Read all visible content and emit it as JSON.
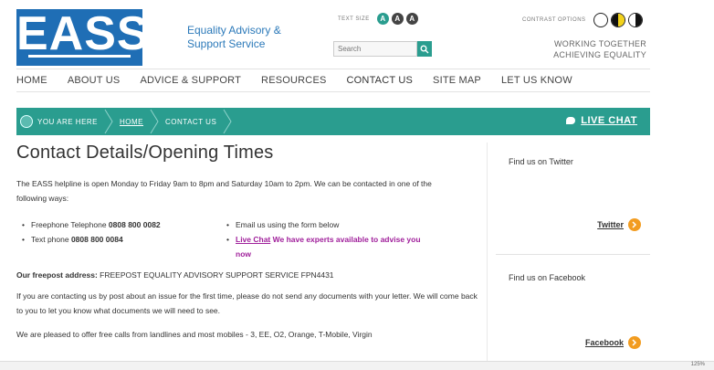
{
  "header": {
    "logo_text": "EASS",
    "org_name": "Equality Advisory & Support Service",
    "text_size_label": "TEXT SIZE",
    "text_size_buttons": [
      "A",
      "A",
      "A"
    ],
    "search_placeholder": "Search",
    "contrast_label": "CONTRAST OPTIONS",
    "tagline_line1": "WORKING TOGETHER",
    "tagline_line2": "ACHIEVING EQUALITY"
  },
  "nav": {
    "items": [
      "HOME",
      "ABOUT US",
      "ADVICE & SUPPORT",
      "RESOURCES",
      "CONTACT US",
      "SITE MAP",
      "LET US KNOW"
    ]
  },
  "breadcrumb": {
    "you_are_here": "YOU ARE HERE",
    "home": "HOME",
    "current": "CONTACT US",
    "live_chat": "LIVE CHAT"
  },
  "main": {
    "title": "Contact Details/Opening Times",
    "intro": "The EASS helpline is open Monday to Friday 9am to 8pm and Saturday 10am to 2pm. We can be contacted in one of the following ways:",
    "left_list": [
      {
        "prefix": "Freephone Telephone ",
        "bold": "0808 800 0082"
      },
      {
        "prefix": "Text phone ",
        "bold": "0808 800 0084"
      }
    ],
    "email_item": "Email us using the form below",
    "live_chat_link": "Live Chat",
    "live_chat_text": " We have experts available to advise you now",
    "freepost_label": "Our freepost address:",
    "freepost_value": " FREEPOST EQUALITY ADVISORY SUPPORT SERVICE FPN4431",
    "para1": "If you are contacting us by post about an issue for the first time, please do not send any documents with your letter. We will come back to you to let you know what documents we will need to see.",
    "para2": "We are pleased to offer free calls from landlines and most mobiles - 3, EE, O2, Orange, T-Mobile, Virgin"
  },
  "sidebar": {
    "twitter_title": "Find us on Twitter",
    "twitter_link": "Twitter",
    "facebook_title": "Find us on Facebook",
    "facebook_link": "Facebook"
  },
  "status": {
    "zoom": "125%"
  },
  "colors": {
    "brand_blue": "#1f6eb5",
    "teal": "#2a9d8f",
    "orange": "#f29c20",
    "live_chat_purple": "#a0209b"
  }
}
